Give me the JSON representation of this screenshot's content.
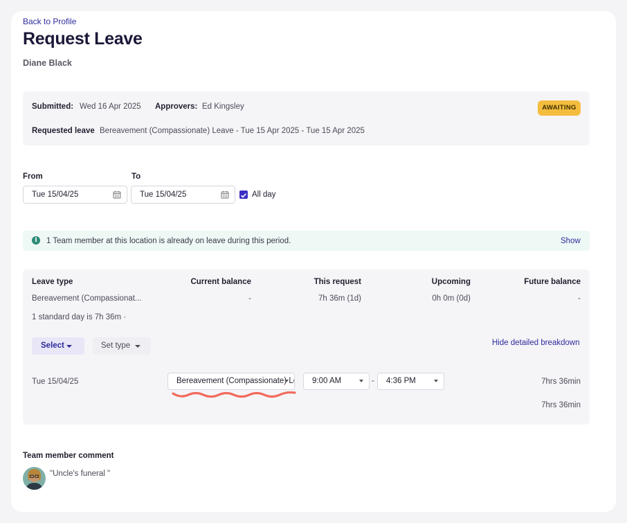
{
  "nav": {
    "back_label": "Back to Profile"
  },
  "page": {
    "title": "Request Leave",
    "employee_name": "Diane Black"
  },
  "summary": {
    "submitted_label": "Submitted:",
    "submitted_value": "Wed 16 Apr 2025",
    "approvers_label": "Approvers:",
    "approvers_value": "Ed Kingsley",
    "requested_label": "Requested leave",
    "requested_value": "Bereavement (Compassionate) Leave - Tue 15 Apr 2025 - Tue 15 Apr 2025",
    "status_badge": "AWAITING",
    "status_color": "#f5bd3e"
  },
  "dates": {
    "from_label": "From",
    "from_value": "Tue 15/04/25",
    "to_label": "To",
    "to_value": "Tue 15/04/25",
    "all_day_label": "All day",
    "all_day_checked": true
  },
  "info": {
    "message": "1 Team member at this location is already on leave during this period.",
    "show_label": "Show"
  },
  "balance_table": {
    "headers": [
      "Leave type",
      "Current balance",
      "This request",
      "Upcoming",
      "Future balance"
    ],
    "row": [
      "Bereavement (Compassionat...",
      "-",
      "7h 36m (1d)",
      "0h 0m (0d)",
      "-"
    ],
    "standard_day_note": "1 standard day is 7h 36m ·"
  },
  "breakdown": {
    "select_label": "Select",
    "set_type_label": "Set type",
    "hide_label": "Hide detailed breakdown",
    "rows": [
      {
        "date": "Tue 15/04/25",
        "leave_type": "Bereavement (Compassionate) Leave",
        "start_time": "9:00 AM",
        "separator": "-",
        "end_time": "4:36 PM",
        "duration": "7hrs 36min"
      }
    ],
    "total": "7hrs 36min"
  },
  "comment": {
    "label": "Team member comment",
    "text": "\"Uncle's funeral \""
  },
  "colors": {
    "accent": "#2d2a9c",
    "checkbox": "#3b30c4",
    "annotation": "#f26b5b",
    "info_bg": "#eef8f5"
  }
}
